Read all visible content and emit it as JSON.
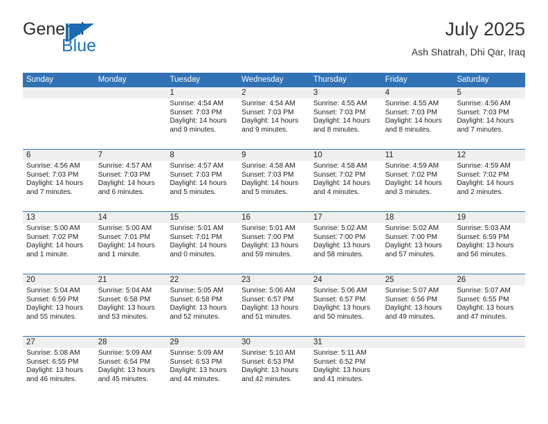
{
  "logo": {
    "word_one": "General",
    "word_two": "Blue",
    "accent_color": "#1a6bb0"
  },
  "header": {
    "title": "July 2025",
    "subtitle": "Ash Shatrah, Dhi Qar, Iraq"
  },
  "theme": {
    "header_blue": "#3172b5",
    "daynum_band": "#efefef",
    "text": "#1d1d1d"
  },
  "calendar": {
    "weekdays": [
      "Sunday",
      "Monday",
      "Tuesday",
      "Wednesday",
      "Thursday",
      "Friday",
      "Saturday"
    ],
    "weeks": [
      [
        {
          "day": "",
          "sunrise": "",
          "sunset": "",
          "daylight": "",
          "empty": true
        },
        {
          "day": "",
          "sunrise": "",
          "sunset": "",
          "daylight": "",
          "empty": true
        },
        {
          "day": "1",
          "sunrise": "Sunrise: 4:54 AM",
          "sunset": "Sunset: 7:03 PM",
          "daylight": "Daylight: 14 hours and 9 minutes."
        },
        {
          "day": "2",
          "sunrise": "Sunrise: 4:54 AM",
          "sunset": "Sunset: 7:03 PM",
          "daylight": "Daylight: 14 hours and 9 minutes."
        },
        {
          "day": "3",
          "sunrise": "Sunrise: 4:55 AM",
          "sunset": "Sunset: 7:03 PM",
          "daylight": "Daylight: 14 hours and 8 minutes."
        },
        {
          "day": "4",
          "sunrise": "Sunrise: 4:55 AM",
          "sunset": "Sunset: 7:03 PM",
          "daylight": "Daylight: 14 hours and 8 minutes."
        },
        {
          "day": "5",
          "sunrise": "Sunrise: 4:56 AM",
          "sunset": "Sunset: 7:03 PM",
          "daylight": "Daylight: 14 hours and 7 minutes."
        }
      ],
      [
        {
          "day": "6",
          "sunrise": "Sunrise: 4:56 AM",
          "sunset": "Sunset: 7:03 PM",
          "daylight": "Daylight: 14 hours and 7 minutes."
        },
        {
          "day": "7",
          "sunrise": "Sunrise: 4:57 AM",
          "sunset": "Sunset: 7:03 PM",
          "daylight": "Daylight: 14 hours and 6 minutes."
        },
        {
          "day": "8",
          "sunrise": "Sunrise: 4:57 AM",
          "sunset": "Sunset: 7:03 PM",
          "daylight": "Daylight: 14 hours and 5 minutes."
        },
        {
          "day": "9",
          "sunrise": "Sunrise: 4:58 AM",
          "sunset": "Sunset: 7:03 PM",
          "daylight": "Daylight: 14 hours and 5 minutes."
        },
        {
          "day": "10",
          "sunrise": "Sunrise: 4:58 AM",
          "sunset": "Sunset: 7:02 PM",
          "daylight": "Daylight: 14 hours and 4 minutes."
        },
        {
          "day": "11",
          "sunrise": "Sunrise: 4:59 AM",
          "sunset": "Sunset: 7:02 PM",
          "daylight": "Daylight: 14 hours and 3 minutes."
        },
        {
          "day": "12",
          "sunrise": "Sunrise: 4:59 AM",
          "sunset": "Sunset: 7:02 PM",
          "daylight": "Daylight: 14 hours and 2 minutes."
        }
      ],
      [
        {
          "day": "13",
          "sunrise": "Sunrise: 5:00 AM",
          "sunset": "Sunset: 7:02 PM",
          "daylight": "Daylight: 14 hours and 1 minute."
        },
        {
          "day": "14",
          "sunrise": "Sunrise: 5:00 AM",
          "sunset": "Sunset: 7:01 PM",
          "daylight": "Daylight: 14 hours and 1 minute."
        },
        {
          "day": "15",
          "sunrise": "Sunrise: 5:01 AM",
          "sunset": "Sunset: 7:01 PM",
          "daylight": "Daylight: 14 hours and 0 minutes."
        },
        {
          "day": "16",
          "sunrise": "Sunrise: 5:01 AM",
          "sunset": "Sunset: 7:00 PM",
          "daylight": "Daylight: 13 hours and 59 minutes."
        },
        {
          "day": "17",
          "sunrise": "Sunrise: 5:02 AM",
          "sunset": "Sunset: 7:00 PM",
          "daylight": "Daylight: 13 hours and 58 minutes."
        },
        {
          "day": "18",
          "sunrise": "Sunrise: 5:02 AM",
          "sunset": "Sunset: 7:00 PM",
          "daylight": "Daylight: 13 hours and 57 minutes."
        },
        {
          "day": "19",
          "sunrise": "Sunrise: 5:03 AM",
          "sunset": "Sunset: 6:59 PM",
          "daylight": "Daylight: 13 hours and 56 minutes."
        }
      ],
      [
        {
          "day": "20",
          "sunrise": "Sunrise: 5:04 AM",
          "sunset": "Sunset: 6:59 PM",
          "daylight": "Daylight: 13 hours and 55 minutes."
        },
        {
          "day": "21",
          "sunrise": "Sunrise: 5:04 AM",
          "sunset": "Sunset: 6:58 PM",
          "daylight": "Daylight: 13 hours and 53 minutes."
        },
        {
          "day": "22",
          "sunrise": "Sunrise: 5:05 AM",
          "sunset": "Sunset: 6:58 PM",
          "daylight": "Daylight: 13 hours and 52 minutes."
        },
        {
          "day": "23",
          "sunrise": "Sunrise: 5:06 AM",
          "sunset": "Sunset: 6:57 PM",
          "daylight": "Daylight: 13 hours and 51 minutes."
        },
        {
          "day": "24",
          "sunrise": "Sunrise: 5:06 AM",
          "sunset": "Sunset: 6:57 PM",
          "daylight": "Daylight: 13 hours and 50 minutes."
        },
        {
          "day": "25",
          "sunrise": "Sunrise: 5:07 AM",
          "sunset": "Sunset: 6:56 PM",
          "daylight": "Daylight: 13 hours and 49 minutes."
        },
        {
          "day": "26",
          "sunrise": "Sunrise: 5:07 AM",
          "sunset": "Sunset: 6:55 PM",
          "daylight": "Daylight: 13 hours and 47 minutes."
        }
      ],
      [
        {
          "day": "27",
          "sunrise": "Sunrise: 5:08 AM",
          "sunset": "Sunset: 6:55 PM",
          "daylight": "Daylight: 13 hours and 46 minutes."
        },
        {
          "day": "28",
          "sunrise": "Sunrise: 5:09 AM",
          "sunset": "Sunset: 6:54 PM",
          "daylight": "Daylight: 13 hours and 45 minutes."
        },
        {
          "day": "29",
          "sunrise": "Sunrise: 5:09 AM",
          "sunset": "Sunset: 6:53 PM",
          "daylight": "Daylight: 13 hours and 44 minutes."
        },
        {
          "day": "30",
          "sunrise": "Sunrise: 5:10 AM",
          "sunset": "Sunset: 6:53 PM",
          "daylight": "Daylight: 13 hours and 42 minutes."
        },
        {
          "day": "31",
          "sunrise": "Sunrise: 5:11 AM",
          "sunset": "Sunset: 6:52 PM",
          "daylight": "Daylight: 13 hours and 41 minutes."
        },
        {
          "day": "",
          "sunrise": "",
          "sunset": "",
          "daylight": "",
          "empty": true
        },
        {
          "day": "",
          "sunrise": "",
          "sunset": "",
          "daylight": "",
          "empty": true
        }
      ]
    ]
  }
}
